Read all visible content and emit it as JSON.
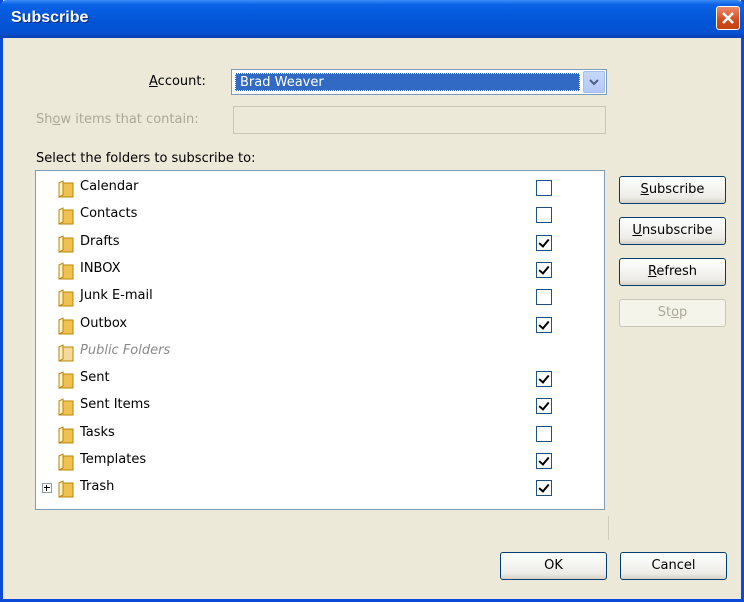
{
  "window": {
    "title": "Subscribe"
  },
  "account": {
    "label_pre": "",
    "label_key": "A",
    "label_post": "ccount:",
    "value": "Brad Weaver"
  },
  "filter": {
    "label_pre": "Sh",
    "label_key": "o",
    "label_post": "w items that contain:",
    "value": ""
  },
  "folders_label": "Select the folders to subscribe to:",
  "folders": [
    {
      "name": "Calendar",
      "checked": false,
      "italic": false,
      "expandable": false
    },
    {
      "name": "Contacts",
      "checked": false,
      "italic": false,
      "expandable": false
    },
    {
      "name": "Drafts",
      "checked": true,
      "italic": false,
      "expandable": false
    },
    {
      "name": "INBOX",
      "checked": true,
      "italic": false,
      "expandable": false
    },
    {
      "name": "Junk E-mail",
      "checked": false,
      "italic": false,
      "expandable": false
    },
    {
      "name": "Outbox",
      "checked": true,
      "italic": false,
      "expandable": false
    },
    {
      "name": "Public Folders",
      "checked": null,
      "italic": true,
      "expandable": false
    },
    {
      "name": "Sent",
      "checked": true,
      "italic": false,
      "expandable": false
    },
    {
      "name": "Sent Items",
      "checked": true,
      "italic": false,
      "expandable": false
    },
    {
      "name": "Tasks",
      "checked": false,
      "italic": false,
      "expandable": false
    },
    {
      "name": "Templates",
      "checked": true,
      "italic": false,
      "expandable": false
    },
    {
      "name": "Trash",
      "checked": true,
      "italic": false,
      "expandable": true
    }
  ],
  "buttons": {
    "subscribe": {
      "key": "S",
      "rest": "ubscribe"
    },
    "unsubscribe": {
      "key": "U",
      "rest": "nsubscribe"
    },
    "refresh": {
      "key": "R",
      "rest": "efresh"
    },
    "stop": {
      "pre": "St",
      "key": "o",
      "rest": "p"
    },
    "ok": "OK",
    "cancel": "Cancel"
  },
  "colors": {
    "titlebar": "#0356d8",
    "selection": "#316ac5",
    "dialog_bg": "#ece9d8",
    "folder": "#f0c050"
  }
}
